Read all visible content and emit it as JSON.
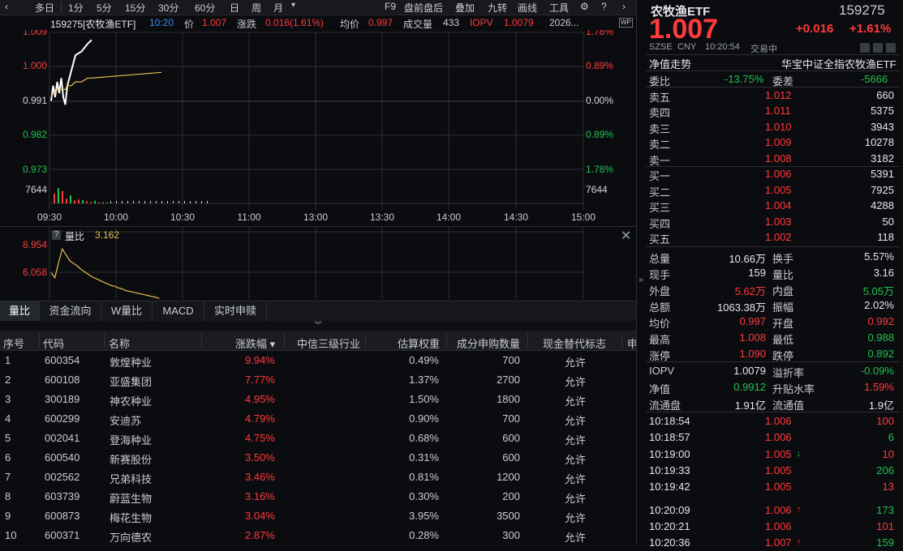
{
  "toolbar": {
    "left_items": [
      "多日",
      "1分",
      "5分",
      "15分",
      "30分",
      "60分",
      "日",
      "周",
      "月"
    ],
    "month_dropdown": "▾",
    "right_items": [
      "F9",
      "盘前盘后",
      "叠加",
      "九转",
      "画线",
      "工具"
    ]
  },
  "infobar": {
    "code_name": "159275[农牧渔ETF]",
    "time": "10:20",
    "price_label": "价",
    "price": "1.007",
    "change_label": "涨跌",
    "change": "0.016(1.61%)",
    "avg_label": "均价",
    "avg": "0.997",
    "vol_label": "成交量",
    "vol": "433",
    "iopv_label": "IOPV",
    "iopv": "1.0079",
    "date": "2026..."
  },
  "main_chart": {
    "y_left": [
      "1.009",
      "1.000",
      "0.991",
      "0.982",
      "0.973",
      "7644"
    ],
    "y_right": [
      "1.78%",
      "0.89%",
      "0.00%",
      "0.89%",
      "1.78%",
      "7644"
    ],
    "x_labels": [
      "09:30",
      "10:00",
      "10:30",
      "11:00",
      "13:00",
      "13:30",
      "14:00",
      "14:30",
      "15:00"
    ]
  },
  "chart_data": {
    "type": "line",
    "x": [
      "09:30",
      "09:31",
      "09:32",
      "09:33",
      "09:34",
      "09:35",
      "09:36",
      "09:37",
      "09:38",
      "09:40",
      "09:42",
      "09:45",
      "09:48",
      "09:50"
    ],
    "series": [
      {
        "values": [
          0.991,
          0.995,
          0.992,
          0.996,
          0.993,
          0.997,
          0.992,
          0.99,
          0.995,
          0.999,
          1.003,
          1.004,
          1.006,
          1.007
        ]
      },
      {
        "values": [
          0.992,
          0.993,
          0.993,
          0.994,
          0.994,
          0.994,
          0.994,
          0.994,
          0.995,
          0.995,
          0.996,
          0.996,
          0.997,
          0.997
        ]
      }
    ],
    "volume": [
      2300,
      3600,
      2900,
      1100,
      1900,
      700,
      900,
      800,
      500,
      300,
      600,
      200,
      300,
      200
    ],
    "ylim": [
      0.973,
      1.009
    ]
  },
  "sub_chart": {
    "help_icon": "?",
    "title": "量比",
    "value": "3.162",
    "y_labels": [
      "8.954",
      "6.058"
    ],
    "ratio_values": [
      6.2,
      5.6,
      7.4,
      9.0,
      8.3,
      7.6,
      7.3,
      7.0,
      6.6,
      6.3,
      6.0,
      5.7,
      5.5,
      5.3,
      5.1,
      4.9,
      4.7,
      4.6,
      4.4,
      4.3,
      4.1,
      4.0,
      3.9,
      3.8,
      3.7,
      3.6,
      3.5,
      3.4,
      3.3,
      3.16
    ],
    "ratio_range": [
      3.0,
      9.5
    ]
  },
  "tabs": [
    "量比",
    "资金流向",
    "W量比",
    "MACD",
    "实时申赎"
  ],
  "table": {
    "headers": [
      "序号",
      "代码",
      "名称",
      "涨跌幅 ▾",
      "中信三级行业",
      "估算权重",
      "成分申购数量",
      "现金替代标志",
      "申"
    ],
    "rows": [
      {
        "no": "1",
        "code": "600354",
        "name": "敦煌种业",
        "chg": "9.94%",
        "industry": "",
        "weight": "0.49%",
        "qty": "700",
        "flag": "允许"
      },
      {
        "no": "2",
        "code": "600108",
        "name": "亚盛集团",
        "chg": "7.77%",
        "industry": "",
        "weight": "1.37%",
        "qty": "2700",
        "flag": "允许"
      },
      {
        "no": "3",
        "code": "300189",
        "name": "神农种业",
        "chg": "4.95%",
        "industry": "",
        "weight": "1.50%",
        "qty": "1800",
        "flag": "允许"
      },
      {
        "no": "4",
        "code": "600299",
        "name": "安迪苏",
        "chg": "4.79%",
        "industry": "",
        "weight": "0.90%",
        "qty": "700",
        "flag": "允许"
      },
      {
        "no": "5",
        "code": "002041",
        "name": "登海种业",
        "chg": "4.75%",
        "industry": "",
        "weight": "0.68%",
        "qty": "600",
        "flag": "允许"
      },
      {
        "no": "6",
        "code": "600540",
        "name": "新赛股份",
        "chg": "3.50%",
        "industry": "",
        "weight": "0.31%",
        "qty": "600",
        "flag": "允许"
      },
      {
        "no": "7",
        "code": "002562",
        "name": "兄弟科技",
        "chg": "3.46%",
        "industry": "",
        "weight": "0.81%",
        "qty": "1200",
        "flag": "允许"
      },
      {
        "no": "8",
        "code": "603739",
        "name": "蔚蓝生物",
        "chg": "3.16%",
        "industry": "",
        "weight": "0.30%",
        "qty": "200",
        "flag": "允许"
      },
      {
        "no": "9",
        "code": "600873",
        "name": "梅花生物",
        "chg": "3.04%",
        "industry": "",
        "weight": "3.95%",
        "qty": "3500",
        "flag": "允许"
      },
      {
        "no": "10",
        "code": "600371",
        "name": "万向德农",
        "chg": "2.87%",
        "industry": "",
        "weight": "0.28%",
        "qty": "300",
        "flag": "允许"
      }
    ]
  },
  "quote": {
    "name": "农牧渔ETF",
    "code": "159275",
    "price": "1.007",
    "change": "+0.016",
    "change_pct": "+1.61%",
    "exchange": "SZSE",
    "currency": "CNY",
    "time": "10:20:54",
    "status": "交易中",
    "nav_trend": "净值走势",
    "full_name": "华宝中证全指农牧渔ETF",
    "weibi_label": "委比",
    "weibi": "-13.75%",
    "weicha_label": "委差",
    "weicha": "-5666"
  },
  "orderbook": {
    "asks": [
      {
        "label": "卖五",
        "price": "1.012",
        "vol": "660"
      },
      {
        "label": "卖四",
        "price": "1.011",
        "vol": "5375"
      },
      {
        "label": "卖三",
        "price": "1.010",
        "vol": "3943"
      },
      {
        "label": "卖二",
        "price": "1.009",
        "vol": "10278"
      },
      {
        "label": "卖一",
        "price": "1.008",
        "vol": "3182"
      }
    ],
    "bids": [
      {
        "label": "买一",
        "price": "1.006",
        "vol": "5391"
      },
      {
        "label": "买二",
        "price": "1.005",
        "vol": "7925"
      },
      {
        "label": "买三",
        "price": "1.004",
        "vol": "4288"
      },
      {
        "label": "买四",
        "price": "1.003",
        "vol": "50"
      },
      {
        "label": "买五",
        "price": "1.002",
        "vol": "118"
      }
    ]
  },
  "stats": [
    {
      "l1": "总量",
      "v1": "10.66万",
      "l2": "换手",
      "v2": "5.57%"
    },
    {
      "l1": "现手",
      "v1": "159",
      "l2": "量比",
      "v2": "3.16"
    },
    {
      "l1": "外盘",
      "v1": "5.62万",
      "l2": "内盘",
      "v2": "5.05万"
    },
    {
      "l1": "总额",
      "v1": "1063.38万",
      "l2": "振幅",
      "v2": "2.02%"
    },
    {
      "l1": "均价",
      "v1": "0.997",
      "l2": "开盘",
      "v2": "0.992"
    },
    {
      "l1": "最高",
      "v1": "1.008",
      "l2": "最低",
      "v2": "0.988"
    },
    {
      "l1": "涨停",
      "v1": "1.090",
      "l2": "跌停",
      "v2": "0.892"
    }
  ],
  "stats2": [
    {
      "l1": "IOPV",
      "v1": "1.0079",
      "l2": "溢折率",
      "v2": "-0.09%"
    },
    {
      "l1": "净值",
      "v1": "0.9912",
      "l2": "升贴水率",
      "v2": "1.59%"
    },
    {
      "l1": "流通盘",
      "v1": "1.91亿",
      "l2": "流通值",
      "v2": "1.9亿"
    }
  ],
  "ticks": [
    {
      "time": "10:18:54",
      "price": "1.006",
      "arrow": "",
      "vol": "100"
    },
    {
      "time": "10:18:57",
      "price": "1.006",
      "arrow": "",
      "vol": "6"
    },
    {
      "time": "10:19:00",
      "price": "1.005",
      "arrow": "↓",
      "vol": "10"
    },
    {
      "time": "10:19:33",
      "price": "1.005",
      "arrow": "",
      "vol": "206"
    },
    {
      "time": "10:19:42",
      "price": "1.005",
      "arrow": "",
      "vol": "13"
    },
    {
      "time": "10:20:09",
      "price": "1.006",
      "arrow": "↑",
      "vol": "173"
    },
    {
      "time": "10:20:21",
      "price": "1.006",
      "arrow": "",
      "vol": "101"
    },
    {
      "time": "10:20:36",
      "price": "1.007",
      "arrow": "↑",
      "vol": "159"
    }
  ]
}
